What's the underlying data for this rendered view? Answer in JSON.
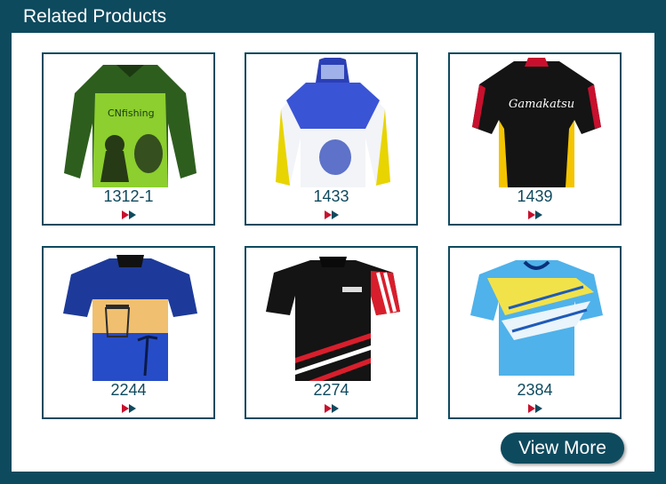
{
  "header": {
    "title": "Related Products"
  },
  "products": [
    {
      "code": "1312-1",
      "image": "long-sleeve-fishing-jersey-green"
    },
    {
      "code": "1433",
      "image": "hooded-fishing-jersey-blue-yellow"
    },
    {
      "code": "1439",
      "image": "short-sleeve-black-jersey-red-trim"
    },
    {
      "code": "2244",
      "image": "polo-shirt-tropical-sunset-print"
    },
    {
      "code": "2274",
      "image": "black-polo-shirt-red-white-stripes"
    },
    {
      "code": "2384",
      "image": "blue-yellow-sublimated-tshirt"
    }
  ],
  "actions": {
    "view_more": "View More"
  },
  "colors": {
    "brand": "#0e4a5e",
    "arrow": "#c8102e"
  }
}
